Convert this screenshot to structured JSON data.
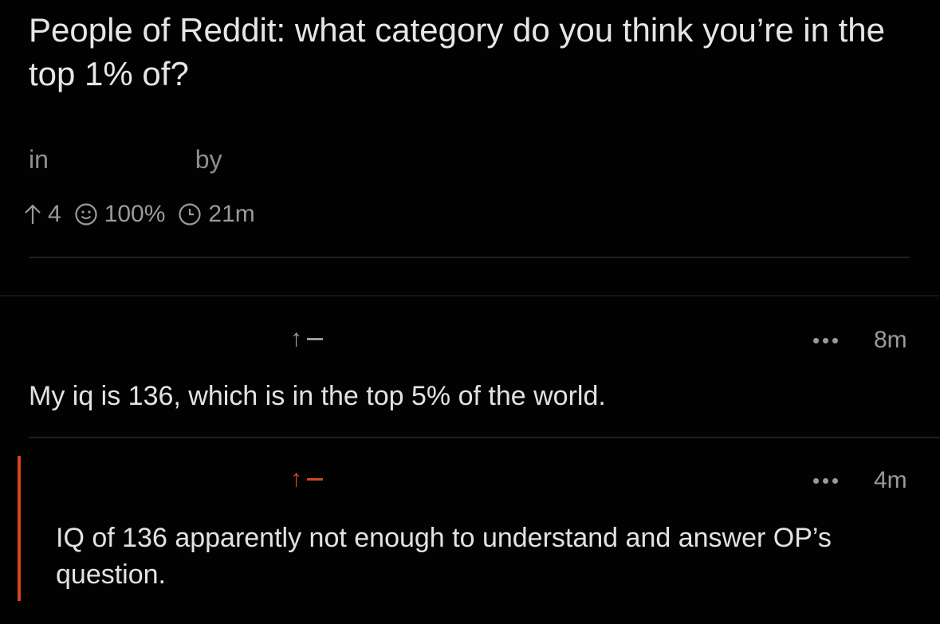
{
  "post": {
    "title": "People of Reddit: what category do you think you’re in the top 1% of?",
    "in_label": "in",
    "by_label": "by",
    "upvotes": "4",
    "upvote_ratio": "100%",
    "age": "21m"
  },
  "comments": [
    {
      "time": "8m",
      "text": "My iq is 136, which is in the top 5% of the world.",
      "arrow": "↑"
    },
    {
      "time": "4m",
      "text": "IQ of 136 apparently not enough to understand and answer OP’s question.",
      "arrow": "↑"
    }
  ],
  "colors": {
    "background": "#020202",
    "accent": "#d4461e",
    "muted": "#9a9a9a"
  }
}
